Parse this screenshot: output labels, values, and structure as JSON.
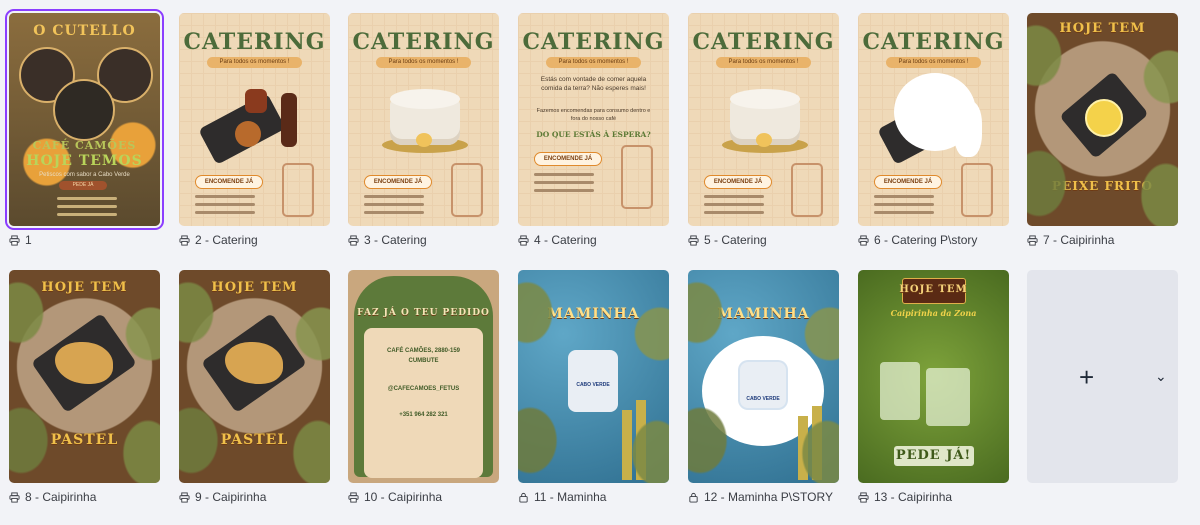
{
  "pages": [
    {
      "caption": "1",
      "icon": "print-icon",
      "poster": {
        "title": "O CUTELLO",
        "headline": "CAFÉ CAMÕES",
        "subhead": "HOJE TEMOS",
        "tagline": "Petiscos com sabor a Cabo Verde",
        "button": "PEDE JÁ"
      }
    },
    {
      "caption": "2 - Catering",
      "icon": "print-icon",
      "poster": {
        "title": "CATERING",
        "ribbon": "Para todos os momentos !",
        "button": "ENCOMENDE JÁ"
      }
    },
    {
      "caption": "3 - Catering",
      "icon": "print-icon",
      "poster": {
        "title": "CATERING",
        "ribbon": "Para todos os momentos !",
        "button": "ENCOMENDE JÁ"
      }
    },
    {
      "caption": "4 - Catering",
      "icon": "print-icon",
      "poster": {
        "title": "CATERING",
        "ribbon": "Para todos os momentos !",
        "body1": "Estás com vontade de comer aquela comida da terra? Não esperes mais!",
        "body2": "Fazemos encomendas para consumo dentro e fora do nosso café",
        "question": "DO QUE ESTÁS À ESPERA?",
        "button": "ENCOMENDE JÁ"
      }
    },
    {
      "caption": "5 - Catering",
      "icon": "print-icon",
      "poster": {
        "title": "CATERING",
        "ribbon": "Para todos os momentos !",
        "button": "ENCOMENDE JÁ"
      }
    },
    {
      "caption": "6 - Catering P\\story",
      "icon": "print-icon",
      "poster": {
        "title": "CATERING",
        "ribbon": "Para todos os momentos !",
        "button": "ENCOMENDE JÁ"
      }
    },
    {
      "caption": "7 - Caipirinha",
      "icon": "print-icon",
      "poster": {
        "title": "HOJE TEM",
        "bottom": "PEIXE FRITO"
      }
    },
    {
      "caption": "8 - Caipirinha",
      "icon": "print-icon",
      "poster": {
        "title": "HOJE TEM",
        "bottom": "PASTEL"
      }
    },
    {
      "caption": "9 - Caipirinha",
      "icon": "print-icon",
      "poster": {
        "title": "HOJE TEM",
        "bottom": "PASTEL"
      }
    },
    {
      "caption": "10 - Caipirinha",
      "icon": "print-icon",
      "poster": {
        "title": "FAZ JÁ O TEU PEDIDO",
        "line1": "CAFÉ CAMÕES, 2880-159",
        "line2": "CUMBUTE",
        "line3": "@CAFECAMOES_FETUS",
        "line4": "+351 964 282 321"
      }
    },
    {
      "caption": "11 - Maminha",
      "icon": "lock-icon",
      "poster": {
        "title": "MAMINHA",
        "label": "CABO VERDE"
      }
    },
    {
      "caption": "12 - Maminha P\\STORY",
      "icon": "lock-icon",
      "poster": {
        "title": "MAMINHA",
        "label": "CABO VERDE"
      }
    },
    {
      "caption": "13 - Caipirinha",
      "icon": "print-icon",
      "poster": {
        "title": "HOJE TEM",
        "script": "Caipirinha da Zona",
        "bottom": "PEDE JÁ!"
      }
    }
  ],
  "add_page": {
    "plus": "+",
    "chevron": "⌄"
  },
  "colors": {
    "selected_outline": "#8b3dff",
    "background": "#f2f3f7"
  }
}
